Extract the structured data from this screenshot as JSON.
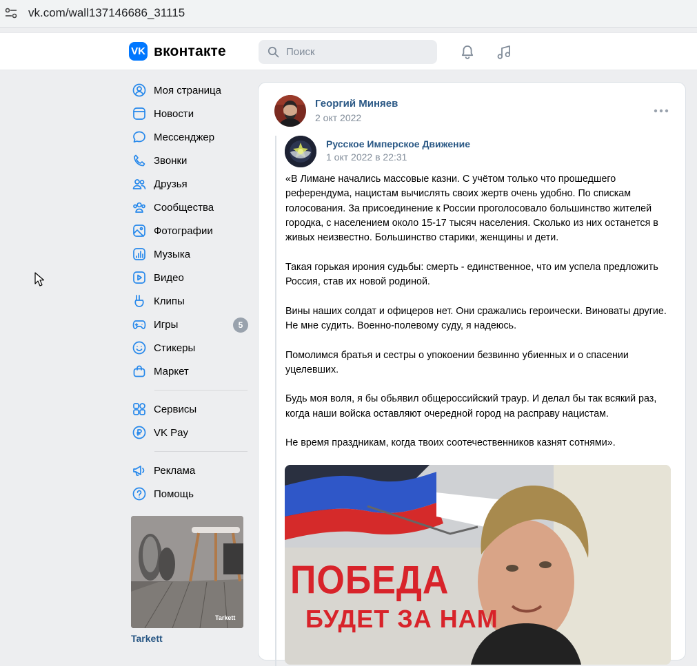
{
  "browser": {
    "url": "vk.com/wall137146686_31115"
  },
  "header": {
    "logo_mark": "VK",
    "logo_text": "вконтакте",
    "search_placeholder": "Поиск"
  },
  "sidebar": {
    "items": [
      {
        "label": "Моя страница",
        "icon": "user-circle-icon"
      },
      {
        "label": "Новости",
        "icon": "news-icon"
      },
      {
        "label": "Мессенджер",
        "icon": "message-icon"
      },
      {
        "label": "Звонки",
        "icon": "phone-icon"
      },
      {
        "label": "Друзья",
        "icon": "friends-icon"
      },
      {
        "label": "Сообщества",
        "icon": "communities-icon"
      },
      {
        "label": "Фотографии",
        "icon": "photo-icon"
      },
      {
        "label": "Музыка",
        "icon": "music-icon"
      },
      {
        "label": "Видео",
        "icon": "video-icon"
      },
      {
        "label": "Клипы",
        "icon": "clips-icon"
      },
      {
        "label": "Игры",
        "icon": "games-icon",
        "badge": "5"
      },
      {
        "label": "Стикеры",
        "icon": "sticker-icon"
      },
      {
        "label": "Маркет",
        "icon": "market-icon"
      }
    ],
    "services": [
      {
        "label": "Сервисы",
        "icon": "services-icon"
      },
      {
        "label": "VK Pay",
        "icon": "vkpay-icon"
      }
    ],
    "extra": [
      {
        "label": "Реклама",
        "icon": "ads-icon"
      },
      {
        "label": "Помощь",
        "icon": "help-icon"
      }
    ],
    "promo_title": "Tarkett",
    "promo_brand": "Tarkett"
  },
  "post": {
    "author": "Георгий Миняев",
    "date": "2 окт 2022",
    "repost": {
      "author": "Русское Имперское Движение",
      "date": "1 окт 2022 в 22:31",
      "paragraphs": [
        "«В Лимане начались массовые казни. С учётом только что прошедшего референдума, нацистам вычислять своих жертв очень удобно. По спискам голосования. За присоединение к России проголосовало большинство жителей городка, с населением около 15-17 тысяч населения. Сколько из них останется в живых неизвестно. Большинство старики, женщины и дети.",
        "Такая горькая ирония судьбы: смерть - единственное, что им успела предложить Россия, став их новой родиной.",
        "Вины наших солдат и офицеров нет. Они сражались героически. Виноваты другие. Не мне судить. Военно-полевому суду, я надеюсь.",
        "Помолимся братья и сестры о упокоении безвинно убиенных и о спасении уцелевших.",
        "Будь моя воля, я бы обьявил общероссийский траур. И делал бы так всякий раз, когда наши войска оставляют очередной город на расправу нацистам.",
        "Не время праздникам, когда твоих соотечественников казнят сотнями»."
      ],
      "photo_text_1": "ПОБЕДА",
      "photo_text_2": "БУДЕТ ЗА НАМ"
    }
  },
  "colors": {
    "accent": "#0077ff",
    "link": "#2a5885",
    "muted": "#818c99",
    "background": "#edeef0"
  }
}
